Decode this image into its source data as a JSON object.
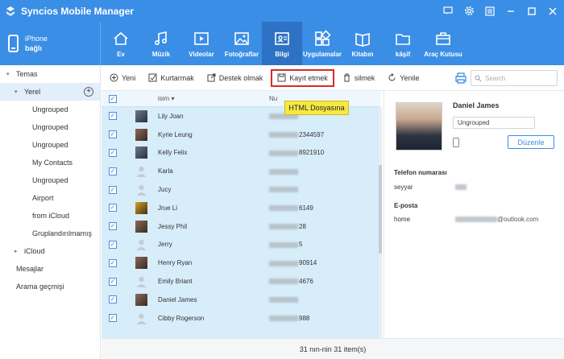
{
  "app": {
    "title": "Syncios Mobile Manager"
  },
  "device": {
    "name": "iPhone",
    "status": "bağlı"
  },
  "nav": [
    {
      "label": "Ev",
      "icon": "home-icon"
    },
    {
      "label": "Müzik",
      "icon": "music-icon"
    },
    {
      "label": "Videolar",
      "icon": "video-icon"
    },
    {
      "label": "Fotoğraflar",
      "icon": "photo-icon"
    },
    {
      "label": "Bilgi",
      "icon": "contact-card-icon",
      "active": true
    },
    {
      "label": "Uygulamalar",
      "icon": "apps-icon"
    },
    {
      "label": "Kitabın",
      "icon": "book-icon"
    },
    {
      "label": "kâşif",
      "icon": "folder-icon"
    },
    {
      "label": "Araç Kutusu",
      "icon": "toolbox-icon"
    }
  ],
  "sidebar": {
    "root": "Temas",
    "local": "Yerel",
    "groups": [
      "Ungrouped",
      "Ungrouped",
      "Ungrouped",
      "My Contacts",
      "Ungrouped",
      "Airport",
      "from iCloud",
      "Gruplandırılmamış"
    ],
    "icloud": "iCloud",
    "messages": "Mesajlar",
    "call_history": "Arama geçmişi"
  },
  "toolbar": {
    "new": "Yeni",
    "recover": "Kurtarmak",
    "backup": "Destek olmak",
    "save": "Kayıt etmek",
    "delete": "silmek",
    "refresh": "Yenile",
    "search_placeholder": "Search"
  },
  "tooltip": "HTML Dosyasına",
  "table": {
    "col_name": "isim",
    "col_number": "Nu",
    "rows": [
      {
        "name": "Lily Joan",
        "num_suffix": "",
        "avatar": "photo2"
      },
      {
        "name": "Kyrie Leung",
        "num_suffix": "2344597",
        "avatar": "photo"
      },
      {
        "name": "Kelly Felix",
        "num_suffix": "8921910",
        "avatar": "photo2"
      },
      {
        "name": "Karla",
        "num_suffix": "",
        "avatar": "default"
      },
      {
        "name": "Jucy",
        "num_suffix": "",
        "avatar": "default"
      },
      {
        "name": "Jrue Li",
        "num_suffix": "6149",
        "avatar": "photo3"
      },
      {
        "name": "Jessy Phil",
        "num_suffix": "28",
        "avatar": "photo"
      },
      {
        "name": "Jerry",
        "num_suffix": "5",
        "avatar": "default"
      },
      {
        "name": "Henry Ryan",
        "num_suffix": "90914",
        "avatar": "photo"
      },
      {
        "name": "Emily Briant",
        "num_suffix": "4676",
        "avatar": "default"
      },
      {
        "name": "Daniel James",
        "num_suffix": "",
        "avatar": "photo"
      },
      {
        "name": "Cibby Rogerson",
        "num_suffix": "988",
        "avatar": "default"
      }
    ]
  },
  "footer": "31 nın-nin 31 item(s)",
  "detail": {
    "name": "Daniel James",
    "group": "Ungrouped",
    "edit": "Düzenle",
    "phone_title": "Telefon numarası",
    "phone_label": "seyyar",
    "email_title": "E-posta",
    "email_label": "home",
    "email_suffix": "@outlook.com"
  }
}
